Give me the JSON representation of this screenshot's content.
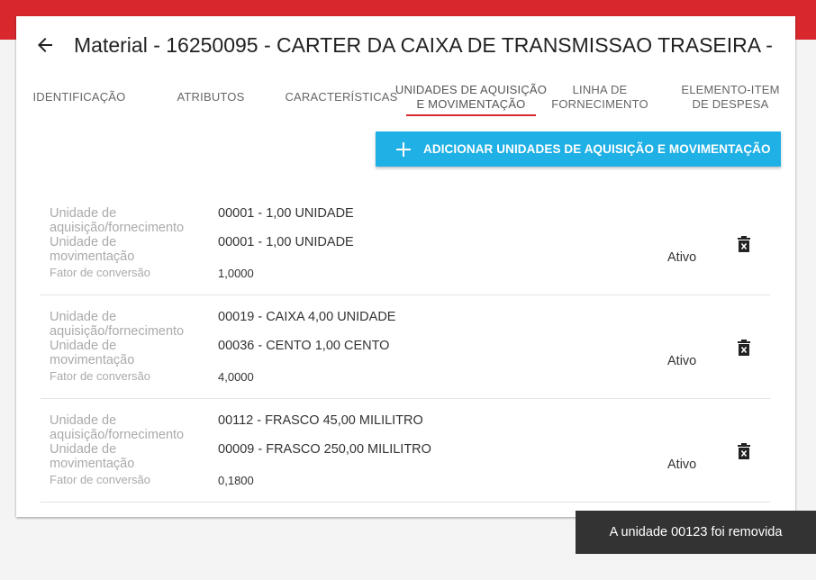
{
  "header": {
    "title": "Material - 16250095 - CARTER DA CAIXA DE TRANSMISSAO TRASEIRA -",
    "back_icon": "arrow-left-icon"
  },
  "tabs": [
    {
      "label": "IDENTIFICAÇÃO",
      "active": false
    },
    {
      "label": "ATRIBUTOS",
      "active": false
    },
    {
      "label": "CARACTERÍSTICAS",
      "active": false
    },
    {
      "label_line1": "UNIDADES DE AQUISIÇÃO",
      "label_line2": "E MOVIMENTAÇÃO",
      "active": true
    },
    {
      "label_line1": "LINHA DE",
      "label_line2": "FORNECIMENTO",
      "active": false
    },
    {
      "label_line1": "ELEMENTO-ITEM",
      "label_line2": "DE DESPESA",
      "active": false
    }
  ],
  "add_button": {
    "label": "ADICIONAR UNIDADES DE AQUISIÇÃO E MOVIMENTAÇÃO",
    "icon": "plus-icon"
  },
  "labels": {
    "acq_line1": "Unidade de",
    "acq_line2": "aquisição/fornecimento",
    "mov_line1": "Unidade de",
    "mov_line2": "movimentação",
    "factor": "Fator de conversão"
  },
  "units": [
    {
      "acquisition": "00001 - 1,00 UNIDADE",
      "movement": "00001 - 1,00 UNIDADE",
      "factor": "1,0000",
      "status": "Ativo"
    },
    {
      "acquisition": "00019 - CAIXA 4,00 UNIDADE",
      "movement": "00036 - CENTO 1,00 CENTO",
      "factor": "4,0000",
      "status": "Ativo"
    },
    {
      "acquisition": "00112 - FRASCO 45,00 MILILITRO",
      "movement": "00009 - FRASCO 250,00 MILILITRO",
      "factor": "0,1800",
      "status": "Ativo"
    }
  ],
  "snackbar": {
    "message": "A unidade 00123 foi removida"
  },
  "colors": {
    "top_bar": "#d8282e",
    "accent_blue": "#1fb0e5",
    "tab_indicator": "#d8282e",
    "snackbar_bg": "#333333"
  }
}
